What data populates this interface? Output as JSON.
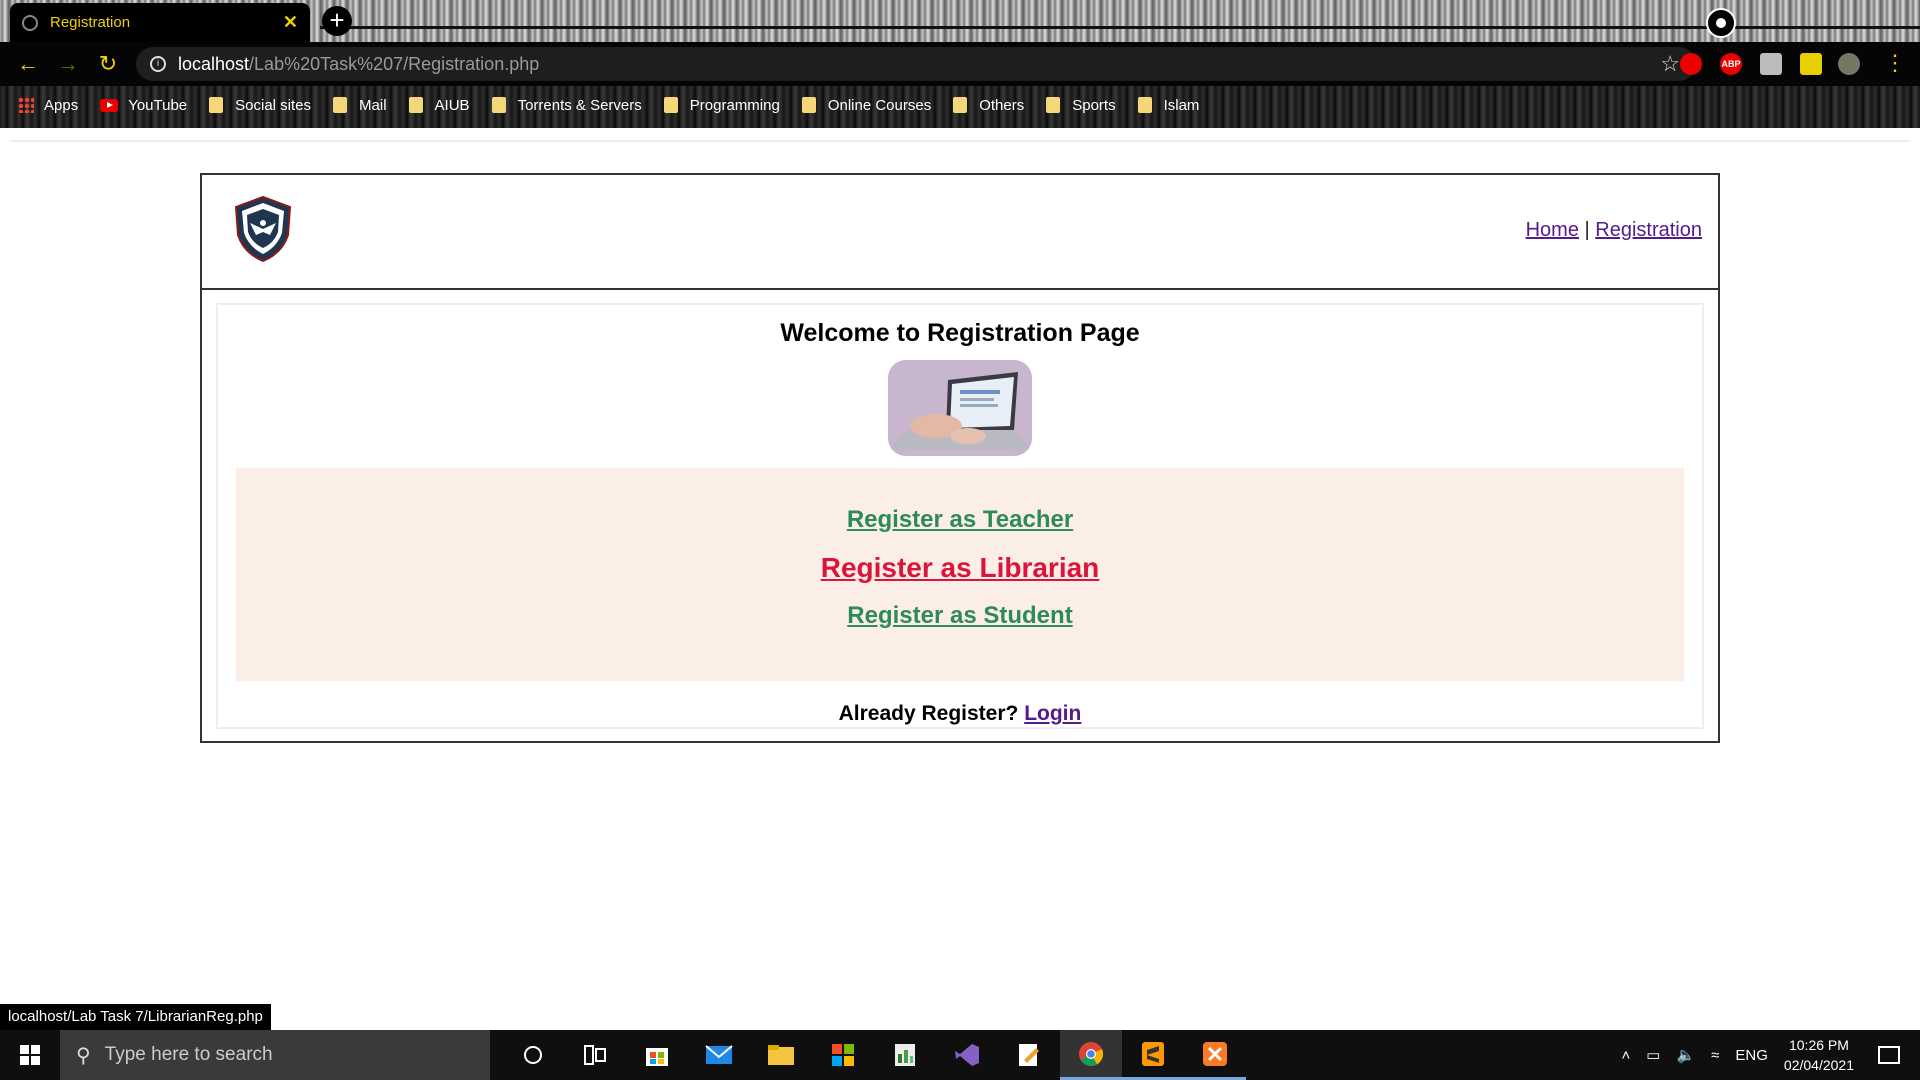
{
  "browser": {
    "tab_title": "Registration",
    "tab_close": "✕",
    "new_tab": "+",
    "url_host": "localhost",
    "url_path": "/Lab%20Task%207/Registration.php",
    "bookmarks": [
      {
        "label": "Apps"
      },
      {
        "label": "YouTube"
      },
      {
        "label": "Social sites"
      },
      {
        "label": "Mail"
      },
      {
        "label": "AIUB"
      },
      {
        "label": "Torrents & Servers"
      },
      {
        "label": "Programming"
      },
      {
        "label": "Online Courses"
      },
      {
        "label": "Others"
      },
      {
        "label": "Sports"
      },
      {
        "label": "Islam"
      }
    ],
    "status_url": "localhost/Lab Task 7/LibrarianReg.php",
    "extension_abp": "ABP"
  },
  "page": {
    "nav": {
      "home": "Home",
      "separator": "|",
      "registration": "Registration"
    },
    "welcome": "Welcome to Registration Page",
    "register_teacher": "Register as Teacher",
    "register_librarian": "Register as Librarian",
    "register_student": "Register as Student",
    "already_text": "Already Register?",
    "login": "Login"
  },
  "taskbar": {
    "search_placeholder": "Type here to search",
    "language": "ENG",
    "time": "10:26 PM",
    "date": "02/04/2021"
  },
  "colors": {
    "tab_text": "#f0d000",
    "teacher_link": "#2e8b57",
    "librarian_link": "#dc143c",
    "panel_bg": "#faeee6",
    "visited_link": "#551a8b"
  }
}
